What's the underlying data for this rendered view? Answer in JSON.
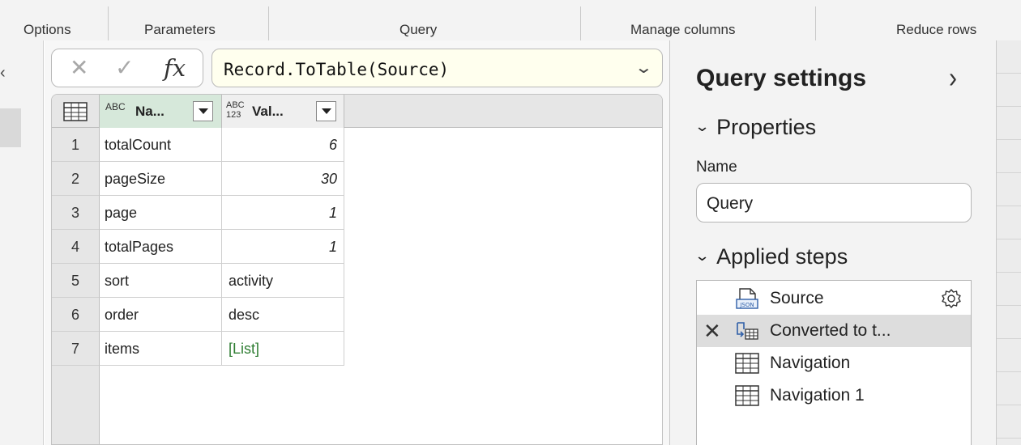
{
  "ribbon": {
    "groups": [
      "Options",
      "Parameters",
      "Query",
      "Manage columns",
      "Reduce rows"
    ]
  },
  "formula_bar": {
    "cancel_icon": "close-icon",
    "commit_icon": "check-icon",
    "fx_label": "fx",
    "formula": "Record.ToTable(Source)",
    "expand_icon": "chevron-down-icon"
  },
  "grid": {
    "columns": [
      {
        "type_badge": "ABC",
        "title": "Na..."
      },
      {
        "type_badge": "ABC 123",
        "title": "Val..."
      }
    ],
    "rows": [
      {
        "num": "1",
        "name": "totalCount",
        "value": "6"
      },
      {
        "num": "2",
        "name": "pageSize",
        "value": "30"
      },
      {
        "num": "3",
        "name": "page",
        "value": "1"
      },
      {
        "num": "4",
        "name": "totalPages",
        "value": "1"
      },
      {
        "num": "5",
        "name": "sort",
        "value": "activity"
      },
      {
        "num": "6",
        "name": "order",
        "value": "desc"
      },
      {
        "num": "7",
        "name": "items",
        "value": "[List]"
      }
    ],
    "colors": {
      "name_header_bg": "#d6e8da",
      "link_green": "#2e7d32"
    }
  },
  "query_settings": {
    "title": "Query settings",
    "collapse_icon": "chevron-right-icon",
    "properties_label": "Properties",
    "name_label": "Name",
    "name_value": "Query",
    "applied_steps_label": "Applied steps",
    "steps": [
      {
        "label": "Source",
        "icon": "json-icon",
        "has_gear": true,
        "selected": false
      },
      {
        "label": "Converted to t...",
        "icon": "convert-table-icon",
        "has_delete": true,
        "selected": true
      },
      {
        "label": "Navigation",
        "icon": "table-icon",
        "selected": false
      },
      {
        "label": "Navigation 1",
        "icon": "table-icon",
        "selected": false
      }
    ]
  }
}
